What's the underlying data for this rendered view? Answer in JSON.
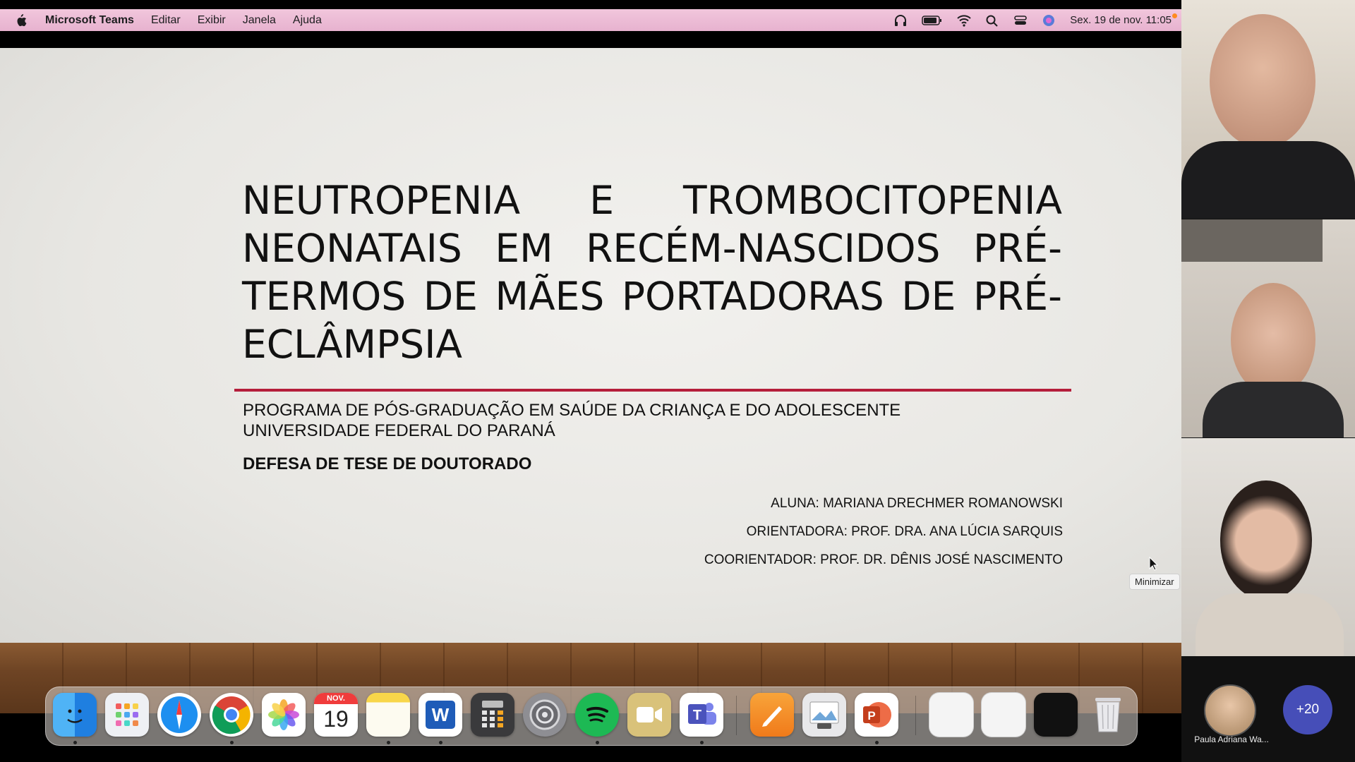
{
  "menubar": {
    "app_name": "Microsoft Teams",
    "menus": [
      "Editar",
      "Exibir",
      "Janela",
      "Ajuda"
    ],
    "datetime": "Sex. 19 de nov.  11:05",
    "icons": [
      "headphones-icon",
      "battery-icon",
      "wifi-icon",
      "search-icon",
      "control-center-icon",
      "siri-icon"
    ]
  },
  "slide": {
    "title_lines": [
      "NEUTROPENIA E TROMBOCITOPENIA",
      "NEONATAIS EM RECÉM-NASCIDOS PRÉ-",
      "TERMOS DE MÃES PORTADORAS DE PRÉ-",
      "ECLÂMPSIA"
    ],
    "program_line1": "PROGRAMA DE PÓS-GRADUAÇÃO EM SAÚDE DA CRIANÇA E DO ADOLESCENTE",
    "program_line2": "UNIVERSIDADE FEDERAL DO PARANÁ",
    "defense": "DEFESA DE TESE DE DOUTORADO",
    "student": "ALUNA: MARIANA DRECHMER ROMANOWSKI",
    "advisor": "ORIENTADORA: PROF. DRA. ANA LÚCIA SARQUIS",
    "coadvisor": "COORIENTADOR: PROF. DR. DÊNIS JOSÉ NASCIMENTO",
    "accent_color": "#b51e3b"
  },
  "tooltip": "Minimizar",
  "dock": {
    "calendar_month": "NOV.",
    "calendar_day": "19",
    "word_letter": "W",
    "items": [
      "finder-icon",
      "launchpad-icon",
      "safari-icon",
      "chrome-icon",
      "photos-icon",
      "calendar-icon",
      "notes-icon",
      "word-icon",
      "calculator-icon",
      "system-preferences-icon",
      "spotify-icon",
      "facetime-icon",
      "teams-icon",
      "pages-icon",
      "preview-icon",
      "powerpoint-icon",
      "window-thumbnail-icon",
      "window-thumbnail-icon",
      "window-thumbnail-icon",
      "trash-icon"
    ]
  },
  "participants": {
    "avatar_name": "Paula Adriana Wa...",
    "more_count": "+20"
  }
}
